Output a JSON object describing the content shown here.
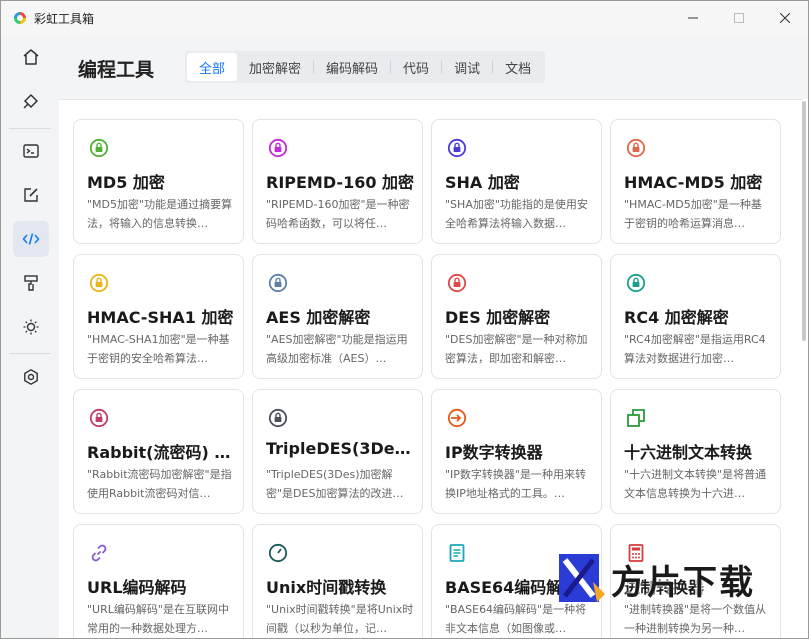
{
  "window": {
    "title": "彩虹工具箱"
  },
  "sidebar": {
    "items": [
      {
        "name": "home-icon",
        "active": false
      },
      {
        "name": "bucket-icon",
        "active": false
      },
      {
        "name": "terminal-icon",
        "active": false
      },
      {
        "name": "edit-icon",
        "active": false
      },
      {
        "name": "code-icon",
        "active": true
      },
      {
        "name": "paint-roller-icon",
        "active": false
      },
      {
        "name": "sun-icon",
        "active": false
      },
      {
        "name": "settings-icon",
        "active": false
      }
    ]
  },
  "header": {
    "title": "编程工具",
    "tabs": [
      "全部",
      "加密解密",
      "编码解码",
      "代码",
      "调试",
      "文档"
    ],
    "active_tab": 0
  },
  "cards": [
    {
      "title": "MD5 加密",
      "desc": "\"MD5加密\"功能是通过摘要算法，将输入的信息转换…",
      "icon": "lock-icon",
      "color": "#52b035"
    },
    {
      "title": "RIPEMD-160 加密",
      "desc": "\"RIPEMD-160加密\"是一种密码哈希函数，可以将任…",
      "icon": "lock-icon",
      "color": "#c22ad6"
    },
    {
      "title": "SHA 加密",
      "desc": "\"SHA加密\"功能指的是使用安全哈希算法将输入数据…",
      "icon": "lock-icon",
      "color": "#4b3bd6"
    },
    {
      "title": "HMAC-MD5 加密",
      "desc": "\"HMAC-MD5加密\"是一种基于密钥的哈希运算消息…",
      "icon": "lock-icon",
      "color": "#e0664a"
    },
    {
      "title": "HMAC-SHA1 加密",
      "desc": "\"HMAC-SHA1加密\"是一种基于密钥的安全哈希算法…",
      "icon": "lock-icon",
      "color": "#e8b418"
    },
    {
      "title": "AES 加密解密",
      "desc": "\"AES加密解密\"功能是指运用高级加密标准（AES）…",
      "icon": "lock-icon",
      "color": "#5a7fa8"
    },
    {
      "title": "DES 加密解密",
      "desc": "\"DES加密解密\"是一种对称加密算法，即加密和解密…",
      "icon": "lock-icon",
      "color": "#e04848"
    },
    {
      "title": "RC4 加密解密",
      "desc": "\"RC4加密解密\"是指运用RC4算法对数据进行加密…",
      "icon": "lock-icon",
      "color": "#1a9e8e"
    },
    {
      "title": "Rabbit(流密码) …",
      "desc": "\"Rabbit流密码加密解密\"是指使用Rabbit流密码对信…",
      "icon": "lock-icon",
      "color": "#c23a6a"
    },
    {
      "title": "TripleDES(3Des)…",
      "desc": "\"TripleDES(3Des)加密解密\"是DES加密算法的改进…",
      "icon": "lock-icon",
      "color": "#4a4f5a"
    },
    {
      "title": "IP数字转换器",
      "desc": "\"IP数字转换器\"是一种用来转换IP地址格式的工具。…",
      "icon": "login-icon",
      "color": "#e8581c"
    },
    {
      "title": "十六进制文本转换",
      "desc": "\"十六进制文本转换\"是将普通文本信息转换为十六进…",
      "icon": "copy-icon",
      "color": "#2a9a3a"
    },
    {
      "title": "URL编码解码",
      "desc": "\"URL编码解码\"是在互联网中常用的一种数据处理方…",
      "icon": "link-icon",
      "color": "#8a5ad6"
    },
    {
      "title": "Unix时间戳转换",
      "desc": "\"Unix时间戳转换\"是将Unix时间戳（以秒为单位，记…",
      "icon": "clock-icon",
      "color": "#1a5a5a"
    },
    {
      "title": "BASE64编码解码",
      "desc": "\"BASE64编码解码\"是一种将非文本信息（如图像或…",
      "icon": "document-icon",
      "color": "#18a8b8"
    },
    {
      "title": "进制转换器",
      "desc": "\"进制转换器\"是将一个数值从一种进制转换为另一种…",
      "icon": "calculator-icon",
      "color": "#d63a3a"
    }
  ],
  "watermark": {
    "text": "方片下载"
  }
}
